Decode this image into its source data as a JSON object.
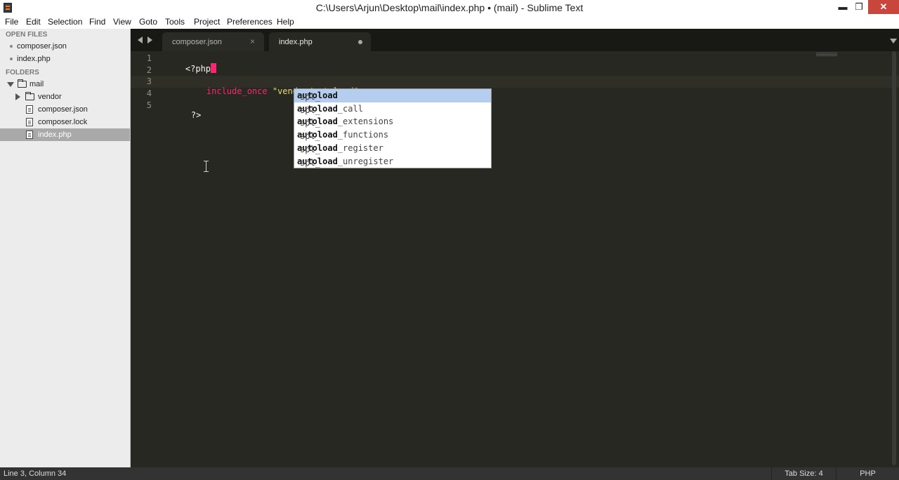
{
  "window": {
    "title": "C:\\Users\\Arjun\\Desktop\\mail\\index.php • (mail) - Sublime Text",
    "minimize": "▬",
    "maximize": "❐",
    "close": "✕"
  },
  "menu": [
    "File",
    "Edit",
    "Selection",
    "Find",
    "View",
    "Goto",
    "Tools",
    "Project",
    "Preferences",
    "Help"
  ],
  "sidebar": {
    "open_files_header": "OPEN FILES",
    "open_files": [
      "composer.json",
      "index.php"
    ],
    "folders_header": "FOLDERS",
    "root_folder": "mail",
    "children": [
      {
        "label": "vendor",
        "type": "folder"
      },
      {
        "label": "composer.json",
        "type": "file"
      },
      {
        "label": "composer.lock",
        "type": "file"
      },
      {
        "label": "index.php",
        "type": "file",
        "selected": true
      }
    ]
  },
  "tabs": [
    {
      "label": "composer.json",
      "close": "×",
      "active": false
    },
    {
      "label": "index.php",
      "active": true,
      "dirty": true
    }
  ],
  "editor": {
    "line_numbers": [
      "1",
      "2",
      "3",
      "4",
      "5"
    ],
    "line1": "<?php",
    "line3_keyword": "include_once",
    "line3_string": "\"vendor/autoload\"",
    "line5": "?>"
  },
  "autocomplete": {
    "items": [
      {
        "prefix": "spl_",
        "match": "autoload",
        "suffix": ""
      },
      {
        "prefix": "spl_",
        "match": "autoload",
        "suffix": "_call"
      },
      {
        "prefix": "spl_",
        "match": "autoload",
        "suffix": "_extensions"
      },
      {
        "prefix": "spl_",
        "match": "autoload",
        "suffix": "_functions"
      },
      {
        "prefix": "spl_",
        "match": "autoload",
        "suffix": "_register"
      },
      {
        "prefix": "spl_",
        "match": "autoload",
        "suffix": "_unregister"
      }
    ],
    "selected_index": 0
  },
  "status": {
    "position": "Line 3, Column 34",
    "tab_size": "Tab Size: 4",
    "syntax": "PHP"
  },
  "colors": {
    "editor_bg": "#272822",
    "keyword": "#f92672",
    "string": "#e6db74",
    "selection": "#b5cdef"
  }
}
